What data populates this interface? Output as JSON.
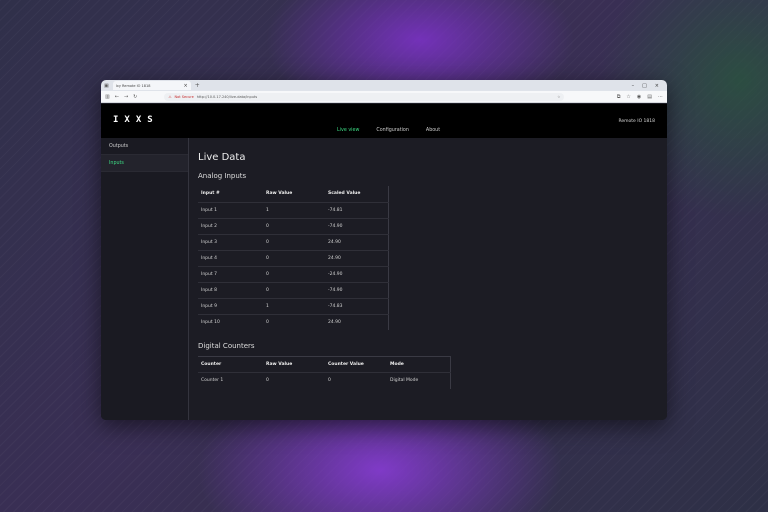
{
  "browser": {
    "tab_title": "Ixy Remote IO 1818",
    "address_security": "Not Secure",
    "address_url": "http://10.0.17.240/live-data/inputs"
  },
  "app": {
    "logo": "IXXS",
    "nav": [
      {
        "label": "Live view",
        "active": true
      },
      {
        "label": "Configuration",
        "active": false
      },
      {
        "label": "About",
        "active": false
      }
    ],
    "device_label": "Remote IO 1818"
  },
  "sidebar": {
    "items": [
      {
        "label": "Outputs",
        "active": false
      },
      {
        "label": "Inputs",
        "active": true
      }
    ]
  },
  "page": {
    "title": "Live Data",
    "analog": {
      "heading": "Analog Inputs",
      "columns": [
        "Input #",
        "Raw Value",
        "Scaled Value"
      ],
      "rows": [
        [
          "Input 1",
          "1",
          "-74.81"
        ],
        [
          "Input 2",
          "0",
          "-74.90"
        ],
        [
          "Input 3",
          "0",
          "24.90"
        ],
        [
          "Input 4",
          "0",
          "24.90"
        ],
        [
          "Input 7",
          "0",
          "-24.90"
        ],
        [
          "Input 8",
          "0",
          "-74.90"
        ],
        [
          "Input 9",
          "1",
          "-74.83"
        ],
        [
          "Input 10",
          "0",
          "24.90"
        ]
      ]
    },
    "digital": {
      "heading": "Digital Counters",
      "columns": [
        "Counter",
        "Raw Value",
        "Counter Value",
        "Mode"
      ],
      "rows": [
        [
          "Counter 1",
          "0",
          "0",
          "Digital Mode"
        ]
      ]
    }
  }
}
